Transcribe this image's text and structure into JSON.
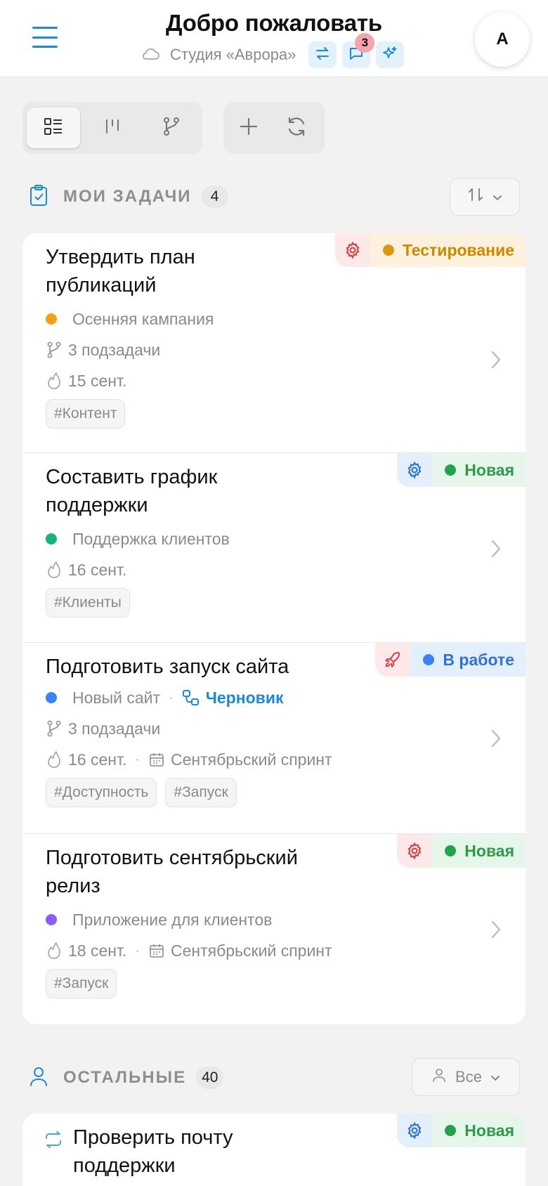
{
  "header": {
    "title": "Добро пожаловать",
    "studio": "Студия «Аврора»",
    "messages_badge": "3",
    "avatar_letter": "A"
  },
  "colors": {
    "accent": "#1d8ad0",
    "testing": "#c98a00",
    "new": "#2e9a4a",
    "in_progress": "#2f74d0"
  },
  "sections": {
    "my_tasks": {
      "title": "МОИ ЗАДАЧИ",
      "count": "4"
    },
    "others": {
      "title": "ОСТАЛЬНЫЕ",
      "count": "40",
      "filter_label": "Все"
    }
  },
  "tasks": [
    {
      "title_line1": "Утвердить план",
      "title_line2": "публикаций",
      "project": "Осенняя кампания",
      "project_color": "#f59f1a",
      "subtasks": "3 подзадачи",
      "due": "15 сент.",
      "tags": [
        "#Контент"
      ],
      "status": "Тестирование",
      "status_icon": "gear-icon"
    },
    {
      "title_line1": "Составить график",
      "title_line2": "поддержки",
      "project": "Поддержка клиентов",
      "project_color": "#16b47a",
      "due": "16 сент.",
      "tags": [
        "#Клиенты"
      ],
      "status": "Новая",
      "status_icon": "gear-icon"
    },
    {
      "title_line1": "Подготовить запуск сайта",
      "project": "Новый сайт",
      "project_color": "#3b82f6",
      "link": "Черновик",
      "subtasks": "3 подзадачи",
      "due": "16 сент.",
      "sprint": "Сентябрьский спринт",
      "tags": [
        "#Доступность",
        "#Запуск"
      ],
      "status": "В работе",
      "status_icon": "rocket-icon"
    },
    {
      "title_line1": "Подготовить сентябрьский",
      "title_line2": "релиз",
      "project": "Приложение для клиентов",
      "project_color": "#8b5cf6",
      "due": "18 сент.",
      "sprint": "Сентябрьский спринт",
      "tags": [
        "#Запуск"
      ],
      "status": "Новая",
      "status_icon": "gear-icon"
    },
    {
      "title_line1": "Проверить почту",
      "title_line2": "поддержки",
      "status": "Новая",
      "status_icon": "gear-icon",
      "type_icon": "repeat-icon"
    }
  ]
}
